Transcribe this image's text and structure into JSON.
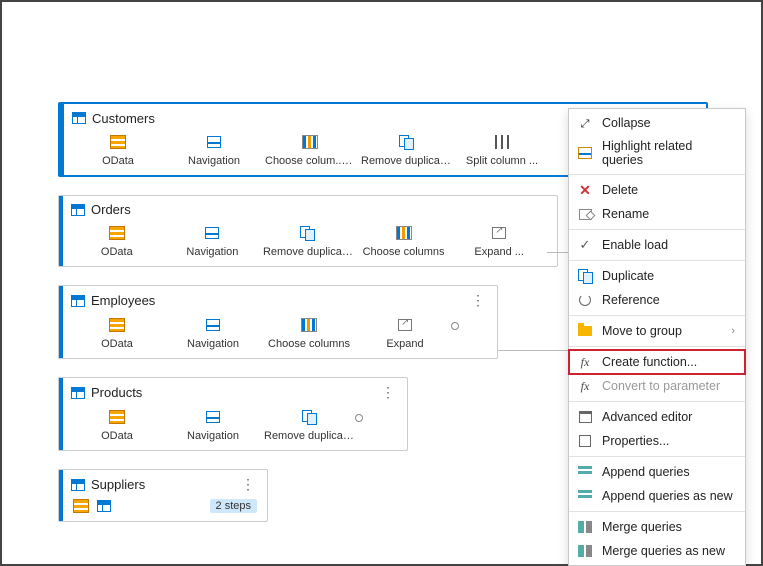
{
  "queries": [
    {
      "name": "Customers",
      "selected": true,
      "steps": [
        "OData",
        "Navigation",
        "Choose colum...",
        "Remove duplicat...",
        "Split column ..."
      ],
      "step_icons": [
        "odata",
        "nav",
        "cols",
        "dup",
        "split"
      ],
      "has_info_on": 2
    },
    {
      "name": "Orders",
      "selected": false,
      "steps": [
        "OData",
        "Navigation",
        "Remove duplicat...",
        "Choose columns",
        "Expand ..."
      ],
      "step_icons": [
        "odata",
        "nav",
        "dup",
        "cols",
        "expand"
      ]
    },
    {
      "name": "Employees",
      "selected": false,
      "steps": [
        "OData",
        "Navigation",
        "Choose columns",
        "Expand"
      ],
      "step_icons": [
        "odata",
        "nav",
        "cols",
        "expand"
      ],
      "show_more": true
    },
    {
      "name": "Products",
      "selected": false,
      "steps": [
        "OData",
        "Navigation",
        "Remove duplicat..."
      ],
      "step_icons": [
        "odata",
        "nav",
        "dup"
      ],
      "show_more": true
    },
    {
      "name": "Suppliers",
      "selected": false,
      "badge": "2 steps",
      "show_more": true,
      "collapsed": true
    }
  ],
  "menu": {
    "groups": [
      [
        {
          "icon": "collapse",
          "label": "Collapse"
        },
        {
          "icon": "highlight",
          "label": "Highlight related queries"
        }
      ],
      [
        {
          "icon": "x",
          "label": "Delete"
        },
        {
          "icon": "rename",
          "label": "Rename"
        }
      ],
      [
        {
          "icon": "check",
          "label": "Enable load"
        }
      ],
      [
        {
          "icon": "dup",
          "label": "Duplicate"
        },
        {
          "icon": "ref",
          "label": "Reference"
        }
      ],
      [
        {
          "icon": "folder",
          "label": "Move to group",
          "arrow": true
        }
      ],
      [
        {
          "icon": "fx",
          "label": "Create function...",
          "highlight": true
        },
        {
          "icon": "fx",
          "label": "Convert to parameter",
          "disabled": true
        }
      ],
      [
        {
          "icon": "adv",
          "label": "Advanced editor"
        },
        {
          "icon": "prop",
          "label": "Properties..."
        }
      ],
      [
        {
          "icon": "append",
          "label": "Append queries"
        },
        {
          "icon": "append",
          "label": "Append queries as new"
        }
      ],
      [
        {
          "icon": "merge",
          "label": "Merge queries"
        },
        {
          "icon": "merge",
          "label": "Merge queries as new"
        }
      ]
    ]
  }
}
